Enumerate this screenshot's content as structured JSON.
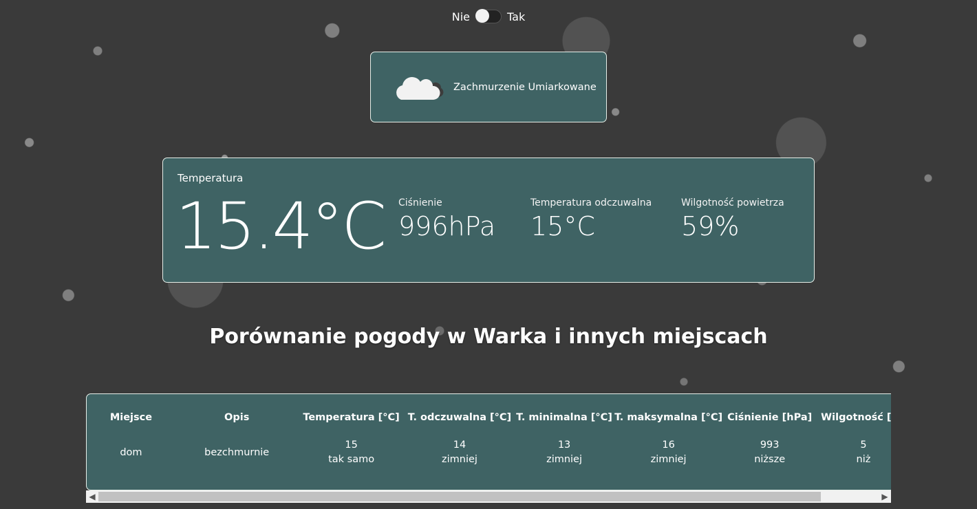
{
  "toggle": {
    "off_label": "Nie",
    "on_label": "Tak",
    "state": "off"
  },
  "condition": {
    "icon": "cloud-icon",
    "description": "Zachmurzenie Umiarkowane"
  },
  "current": {
    "temp_label": "Temperatura",
    "temp_value": "15.4°C",
    "pressure_label": "Ciśnienie",
    "pressure_value": "996hPa",
    "feels_label": "Temperatura odczuwalna",
    "feels_value": "15°C",
    "humidity_label": "Wilgotność powietrza",
    "humidity_value": "59%"
  },
  "comparison": {
    "title": "Porównanie pogody w Warka i innych miejscach",
    "headers": [
      "Miejsce",
      "Opis",
      "Temperatura [°C]",
      "T. odczuwalna [°C]",
      "T. minimalna [°C]",
      "T. maksymalna [°C]",
      "Ciśnienie [hPa]",
      "Wilgotność [%]"
    ],
    "rows": [
      {
        "place": "dom",
        "desc": "bezchmurnie",
        "temp": "15",
        "temp_cmp": "tak samo",
        "feels": "14",
        "feels_cmp": "zimniej",
        "min": "13",
        "min_cmp": "zimniej",
        "max": "16",
        "max_cmp": "zimniej",
        "pressure": "993",
        "pressure_cmp": "niższe",
        "humidity": "5",
        "humidity_cmp": "niż"
      }
    ]
  }
}
